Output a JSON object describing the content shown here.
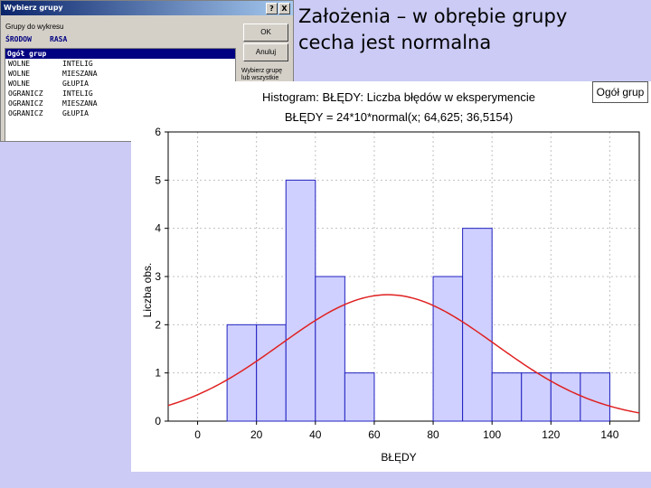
{
  "dialog": {
    "title": "Wybierz grupy",
    "help": "?",
    "close": "X",
    "label": "Grupy do wykresu",
    "columns": [
      "ŚRODOW",
      "RASA"
    ],
    "selected": "Ogół grup",
    "rows": [
      [
        "WOLNE",
        "INTELIG"
      ],
      [
        "WOLNE",
        "MIESZANA"
      ],
      [
        "WOLNE",
        "GŁUPIA"
      ],
      [
        "OGRANICZ",
        "INTELIG"
      ],
      [
        "OGRANICZ",
        "MIESZANA"
      ],
      [
        "OGRANICZ",
        "GŁUPIA"
      ]
    ],
    "ok_label": "OK",
    "cancel_label": "Anuluj",
    "note": "Wybierz grupę lub wszystkie"
  },
  "slide": {
    "title_line1": "Założenia – w obrębie grupy",
    "title_line2": "cecha jest normalna"
  },
  "group_button": "Ogół grup",
  "chart_data": {
    "type": "bar",
    "title": "Histogram: BŁĘDY: Liczba błędów w eksperymencie",
    "subtitle": "BŁĘDY = 24*10*normal(x; 64,625; 36,5154)",
    "xlabel": "BŁĘDY",
    "ylabel": "Liczba obs.",
    "xlim": [
      -10,
      150
    ],
    "ylim": [
      0,
      6
    ],
    "xticks": [
      0,
      20,
      40,
      60,
      80,
      100,
      120,
      140
    ],
    "yticks": [
      0,
      1,
      2,
      3,
      4,
      5,
      6
    ],
    "bin_width": 10,
    "bins": [
      {
        "x0": 10,
        "count": 2
      },
      {
        "x0": 20,
        "count": 2
      },
      {
        "x0": 30,
        "count": 5
      },
      {
        "x0": 40,
        "count": 3
      },
      {
        "x0": 50,
        "count": 1
      },
      {
        "x0": 60,
        "count": 0
      },
      {
        "x0": 70,
        "count": 0
      },
      {
        "x0": 80,
        "count": 3
      },
      {
        "x0": 90,
        "count": 4
      },
      {
        "x0": 100,
        "count": 1
      },
      {
        "x0": 110,
        "count": 1
      },
      {
        "x0": 120,
        "count": 1
      },
      {
        "x0": 130,
        "count": 1
      }
    ],
    "normal_curve": {
      "n": 24,
      "width": 10,
      "mean": 64.625,
      "sd": 36.5154
    },
    "colors": {
      "bar_fill": "#cfd0ff",
      "bar_stroke": "#2020c0",
      "curve": "#e02020",
      "grid": "#c0c0c0"
    }
  }
}
